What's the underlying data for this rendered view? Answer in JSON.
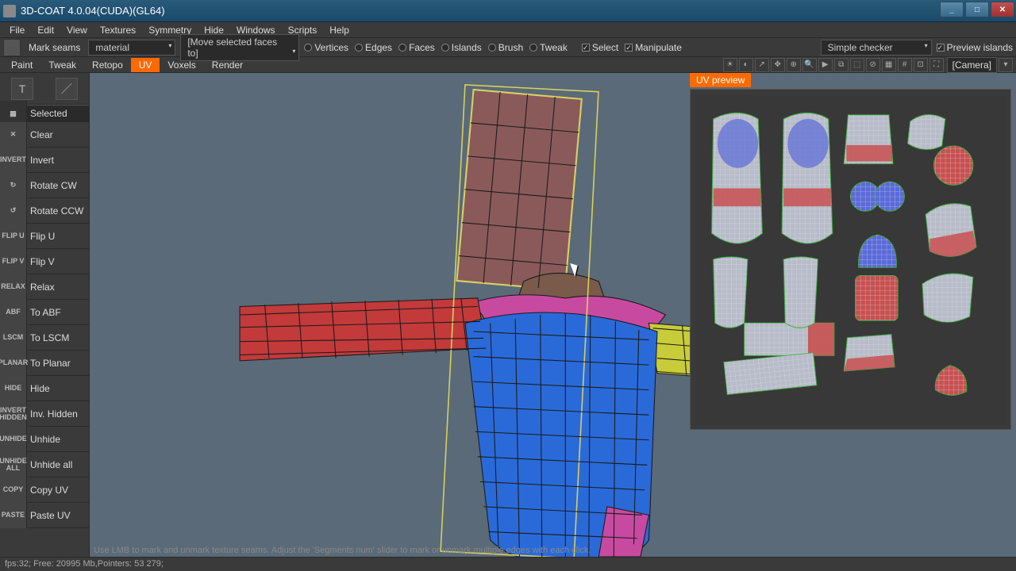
{
  "title": "3D-COAT 4.0.04(CUDA)(GL64)",
  "menu": [
    "File",
    "Edit",
    "View",
    "Textures",
    "Symmetry",
    "Hide",
    "Windows",
    "Scripts",
    "Help"
  ],
  "toolbar": {
    "mark_seams": "Mark seams",
    "material_dd": "material",
    "move_dd": "[Move selected faces to]",
    "radios": [
      "Vertices",
      "Edges",
      "Faces",
      "Islands",
      "Brush",
      "Tweak"
    ],
    "checks": [
      {
        "label": "Select",
        "on": true
      },
      {
        "label": "Manipulate",
        "on": true
      }
    ],
    "checker_dd": "Simple checker",
    "preview_check": {
      "label": "Preview islands",
      "on": true
    }
  },
  "modes": [
    "Paint",
    "Tweak",
    "Retopo",
    "UV",
    "Voxels",
    "Render"
  ],
  "active_mode": "UV",
  "camera_btn": "[Camera]",
  "left_header": "Selected",
  "left_buttons": [
    {
      "icon": "✕",
      "label": "Clear",
      "name": "clear"
    },
    {
      "icon": "INVERT",
      "label": "Invert",
      "name": "invert"
    },
    {
      "icon": "↻",
      "label": "Rotate CW",
      "name": "rotate-cw"
    },
    {
      "icon": "↺",
      "label": "Rotate CCW",
      "name": "rotate-ccw"
    },
    {
      "icon": "FLIP U",
      "label": "Flip U",
      "name": "flip-u"
    },
    {
      "icon": "FLIP V",
      "label": "Flip V",
      "name": "flip-v"
    },
    {
      "icon": "RELAX",
      "label": "Relax",
      "name": "relax"
    },
    {
      "icon": "ABF",
      "label": "To ABF",
      "name": "to-abf"
    },
    {
      "icon": "LSCM",
      "label": "To LSCM",
      "name": "to-lscm"
    },
    {
      "icon": "PLANAR",
      "label": "To Planar",
      "name": "to-planar"
    },
    {
      "icon": "HIDE",
      "label": "Hide",
      "name": "hide"
    },
    {
      "icon": "INVERT\nHIDDEN",
      "label": "Inv. Hidden",
      "name": "inv-hidden"
    },
    {
      "icon": "UNHIDE",
      "label": "Unhide",
      "name": "unhide"
    },
    {
      "icon": "UNHIDE\nALL",
      "label": "Unhide all",
      "name": "unhide-all"
    },
    {
      "icon": "COPY",
      "label": "Copy UV",
      "name": "copy-uv"
    },
    {
      "icon": "PASTE",
      "label": "Paste UV",
      "name": "paste-uv"
    }
  ],
  "uv_preview_title": "UV preview",
  "hint": "Use LMB to mark and unmark texture seams. Adjust the 'Segments num' slider to mark or unmark multiple edges with each click.",
  "status": "fps:32;    Free: 20995 Mb,Pointers: 53 279;",
  "colors": {
    "torso": "#2a6ad8",
    "arm_l": "#c23a3a",
    "arm_r": "#c8cc3a",
    "shoulder": "#c84aa0",
    "head_top": "#8a5a5a",
    "neck": "#7a4a4a",
    "hip": "#c84aa0",
    "sel": "#d8d060",
    "uv_red": "#c85050",
    "uv_blue": "#5a6ad8",
    "uv_grey": "#b8bcc8"
  }
}
